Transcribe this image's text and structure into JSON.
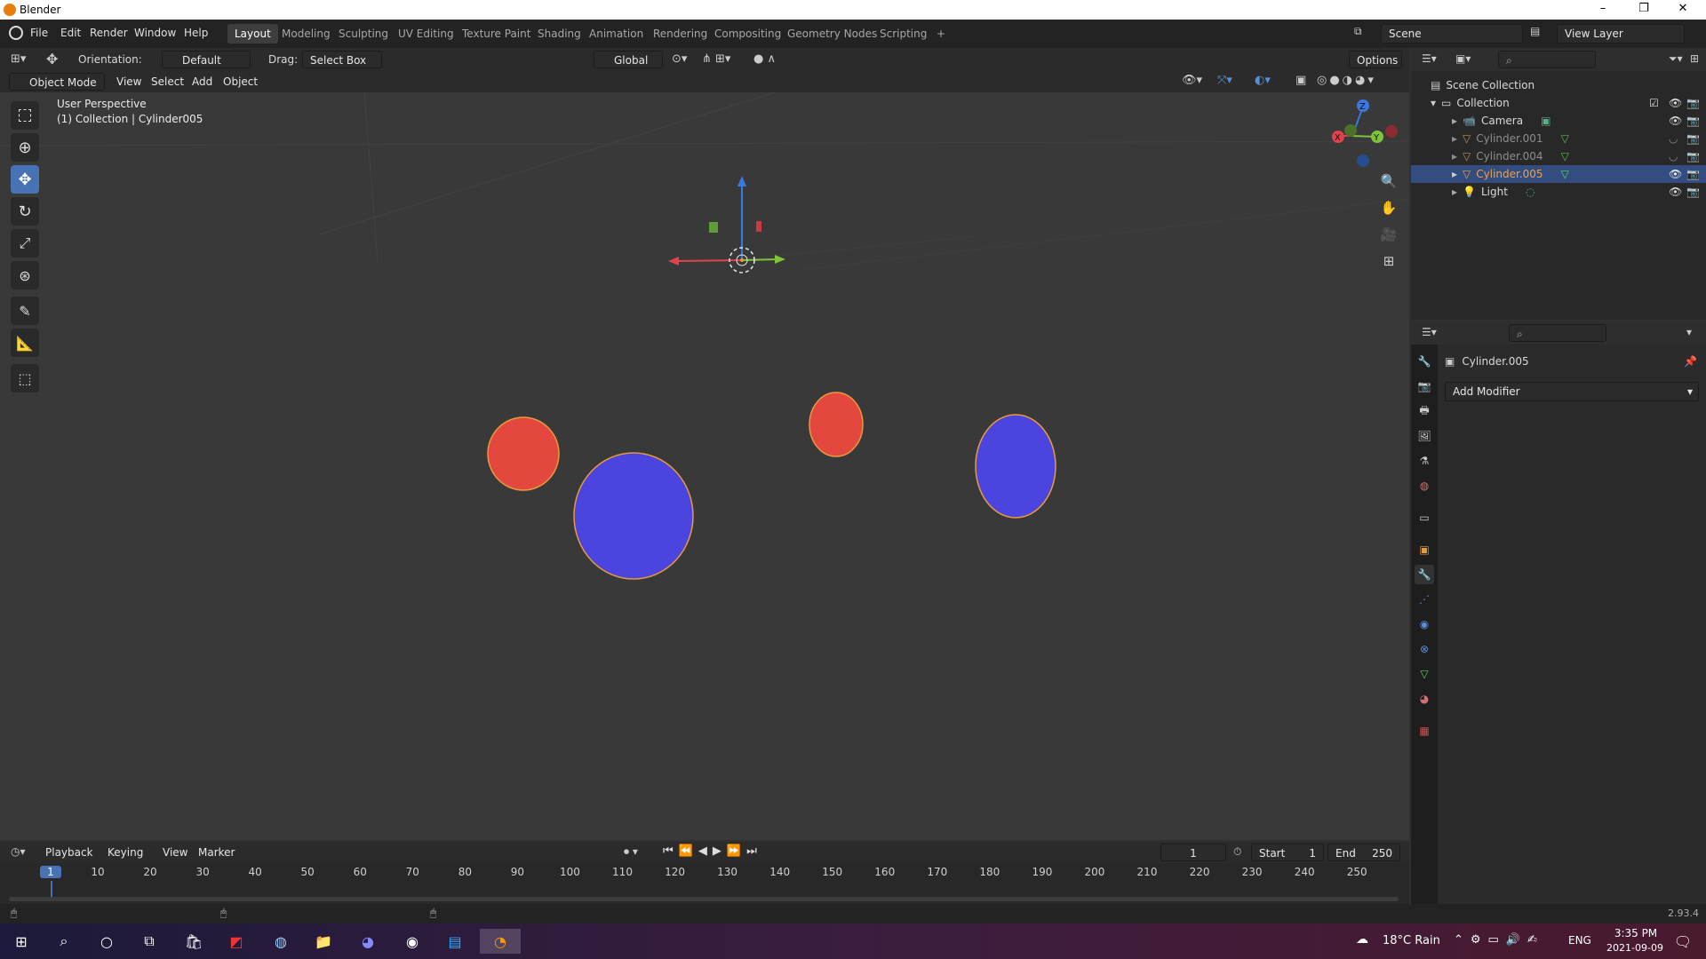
{
  "window": {
    "title": "Blender",
    "minimize": "–",
    "restore": "❐",
    "close": "✕"
  },
  "menu": {
    "items": [
      "File",
      "Edit",
      "Render",
      "Window",
      "Help"
    ]
  },
  "workspaces": {
    "tabs": [
      "Layout",
      "Modeling",
      "Sculpting",
      "UV Editing",
      "Texture Paint",
      "Shading",
      "Animation",
      "Rendering",
      "Compositing",
      "Geometry Nodes",
      "Scripting"
    ],
    "active": "Layout",
    "add": "+"
  },
  "scene": {
    "name": "Scene",
    "view_layer": "View Layer"
  },
  "tool_header": {
    "orientation_label": "Orientation:",
    "orientation_value": "Default",
    "drag_label": "Drag:",
    "drag_value": "Select Box",
    "transform_orientation": "Global",
    "options": "Options"
  },
  "viewport_header": {
    "mode": "Object Mode",
    "menus": [
      "View",
      "Select",
      "Add",
      "Object"
    ]
  },
  "viewport": {
    "perspective_label": "User Perspective",
    "collection_label": "(1) Collection | Cylinder005",
    "colors": {
      "red": "#e4473e",
      "blue": "#4b44de",
      "outline": "#e89a3c"
    }
  },
  "outliner": {
    "root": "Scene Collection",
    "collection": "Collection",
    "items": [
      {
        "name": "Camera",
        "icon": "camera-icon",
        "selected": false,
        "dim": false
      },
      {
        "name": "Cylinder.001",
        "icon": "mesh-icon",
        "selected": false,
        "dim": true
      },
      {
        "name": "Cylinder.004",
        "icon": "mesh-icon",
        "selected": false,
        "dim": true
      },
      {
        "name": "Cylinder.005",
        "icon": "mesh-icon",
        "selected": true,
        "dim": false
      },
      {
        "name": "Light",
        "icon": "light-icon",
        "selected": false,
        "dim": false
      }
    ]
  },
  "properties": {
    "object_name": "Cylinder.005",
    "add_modifier": "Add Modifier"
  },
  "timeline": {
    "menus": [
      "Playback",
      "Keying",
      "View",
      "Marker"
    ],
    "current_frame": "1",
    "start_label": "Start",
    "start_value": "1",
    "end_label": "End",
    "end_value": "250",
    "ticks": [
      "1",
      "10",
      "20",
      "30",
      "40",
      "50",
      "60",
      "70",
      "80",
      "90",
      "100",
      "110",
      "120",
      "130",
      "140",
      "150",
      "160",
      "170",
      "180",
      "190",
      "200",
      "210",
      "220",
      "230",
      "240",
      "250"
    ]
  },
  "status": {
    "version": "2.93.4"
  },
  "taskbar": {
    "weather": "18°C Rain",
    "language": "ENG",
    "time": "3:35 PM",
    "date": "2021-09-09"
  }
}
